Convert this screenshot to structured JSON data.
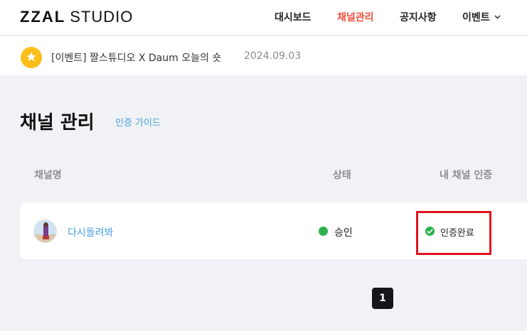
{
  "header": {
    "logo_bold": "ZZAL",
    "logo_light": "STUDIO",
    "nav": [
      "대시보드",
      "채널관리",
      "공지사항",
      "이벤트"
    ]
  },
  "notice": {
    "icon": "star-icon",
    "title": "[이벤트] 짤스튜디오 X Daum 오늘의 숏",
    "date": "2024.09.03"
  },
  "main": {
    "title": "채널 관리",
    "guide_link": "인증 가이드",
    "columns": [
      "채널명",
      "상태",
      "내 채널 인증"
    ],
    "rows": [
      {
        "channel": "다시돌려봐",
        "status": "승인",
        "certification": "인증완료"
      }
    ]
  },
  "pagination": {
    "current_page": "1"
  },
  "colors": {
    "accent": "#f24e3a",
    "link": "#4aa3df",
    "success": "#2bb24c",
    "highlight": "#e0141e"
  }
}
